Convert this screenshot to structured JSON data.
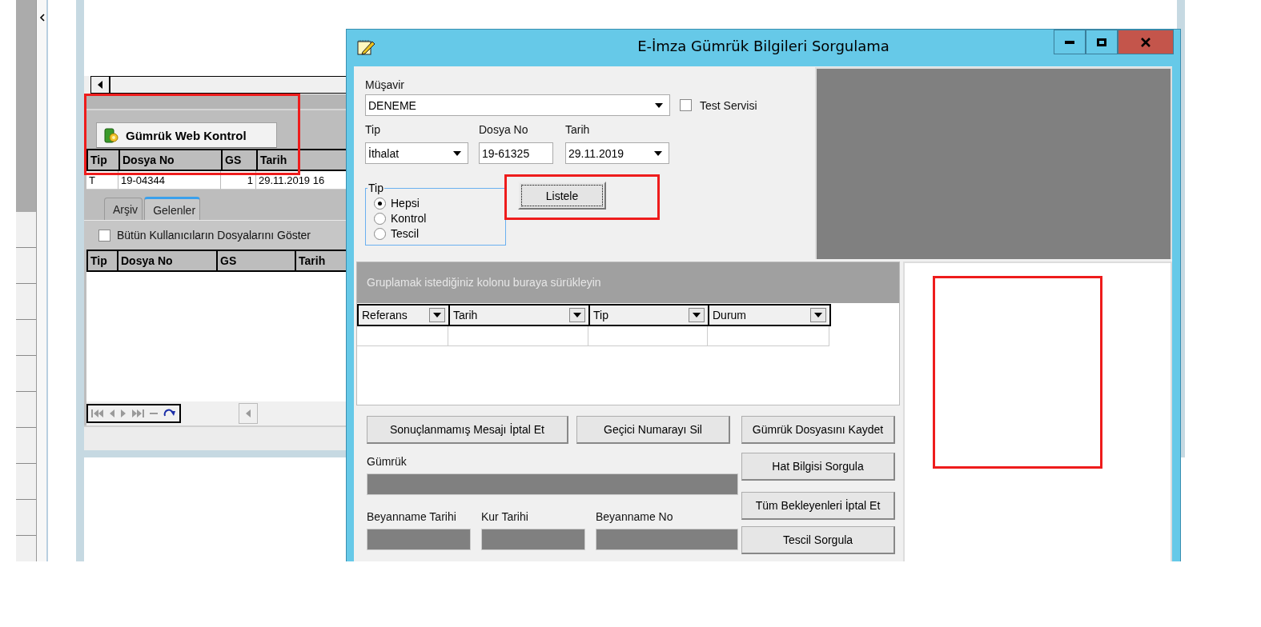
{
  "background_window": {
    "toolbar_button": "Gümrük Web Kontrol",
    "upper_grid": {
      "columns": [
        "Tip",
        "Dosya No",
        "GS",
        "Tarih"
      ],
      "rows": [
        [
          "T",
          "19-04344",
          "1",
          "29.11.2019 16"
        ]
      ]
    },
    "tabs": [
      {
        "label": "Arşiv",
        "selected": false
      },
      {
        "label": "Gelenler",
        "selected": true
      }
    ],
    "show_all_users": {
      "label": "Bütün Kullanıcıların Dosyalarını Göster",
      "checked": false
    },
    "lower_grid": {
      "columns": [
        "Tip",
        "Dosya No",
        "GS",
        "Tarih"
      ]
    }
  },
  "dialog": {
    "title": "E-İmza Gümrük Bilgileri Sorgulama",
    "musavir": {
      "label": "Müşavir",
      "value": "DENEME"
    },
    "test_service": {
      "label": "Test Servisi",
      "checked": false
    },
    "tip": {
      "label": "Tip",
      "value": "İthalat"
    },
    "dosya_no": {
      "label": "Dosya No",
      "value": "19-61325"
    },
    "tarih": {
      "label": "Tarih",
      "value": "29.11.2019"
    },
    "tip_group": {
      "legend": "Tip",
      "options": [
        {
          "label": "Hepsi",
          "selected": true
        },
        {
          "label": "Kontrol",
          "selected": false
        },
        {
          "label": "Tescil",
          "selected": false
        }
      ]
    },
    "list_button": "Listele",
    "group_hint": "Gruplamak istediğiniz kolonu buraya sürükleyin",
    "result_grid": {
      "columns": [
        "Referans",
        "Tarih",
        "Tip",
        "Durum"
      ]
    },
    "left_buttons": [
      "Sonuçlanmamış Mesajı İptal Et",
      "Geçici Numarayı Sil"
    ],
    "gumruk_label": "Gümrük",
    "fields": [
      "Beyanname Tarihi",
      "Kur Tarihi",
      "Beyanname No"
    ],
    "side_buttons": [
      "Gümrük Dosyasını Kaydet",
      "Hat Bilgisi Sorgula",
      "Tüm Bekleyenleri İptal Et",
      "Tescil Sorgula"
    ]
  }
}
